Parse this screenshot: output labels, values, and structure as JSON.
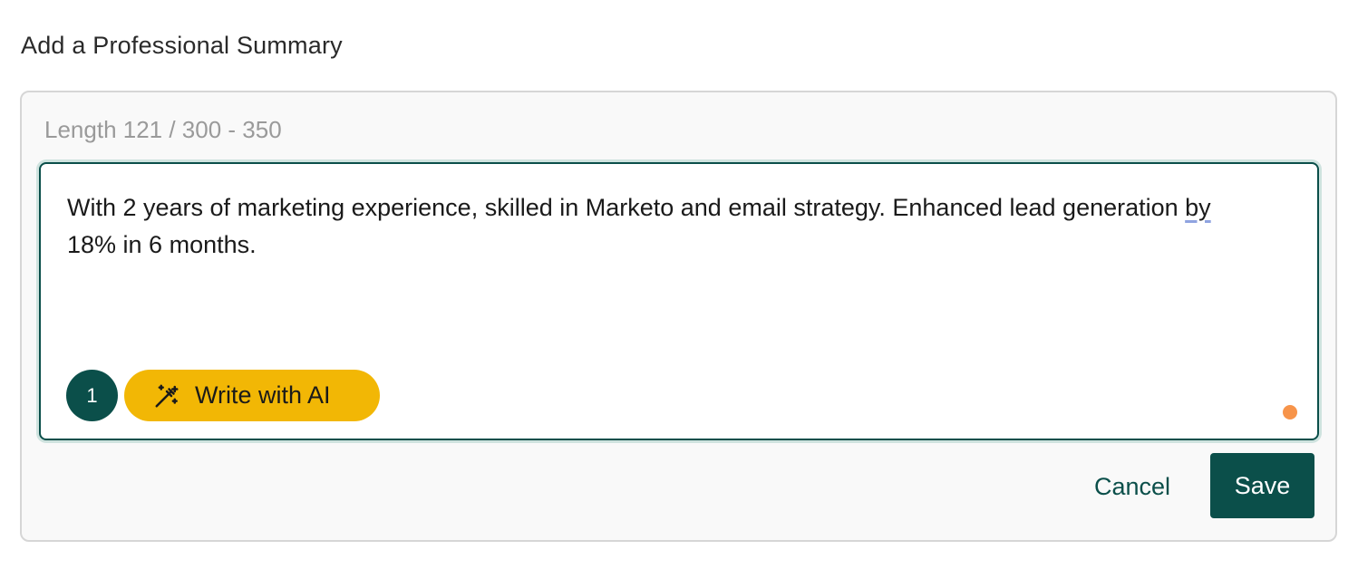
{
  "section": {
    "title": "Add a Professional Summary"
  },
  "summary": {
    "length_label": "Length 121 / 300 - 350",
    "text_part1": "With 2 years of marketing experience, skilled in Marketo and email strategy. Enhanced lead generation ",
    "text_flagged": "by",
    "text_part2": " 18% in 6 months.",
    "suggestion_count": "1",
    "ai_button_label": "Write with AI",
    "status_dot_color": "#f7944a"
  },
  "actions": {
    "cancel_label": "Cancel",
    "save_label": "Save"
  },
  "theme": {
    "primary": "#0b4f4a",
    "accent": "#f2b705"
  },
  "icons": {
    "ai_button": "magic-wand-icon"
  }
}
